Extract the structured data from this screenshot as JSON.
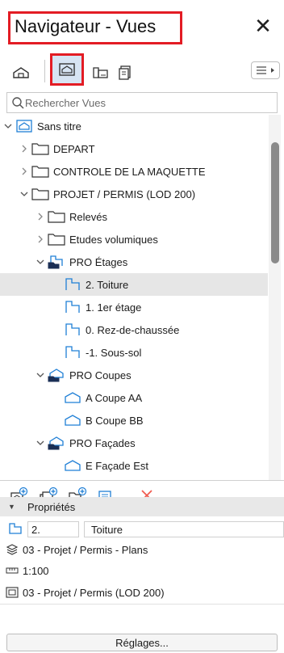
{
  "window": {
    "title": "Navigateur - Vues",
    "close_icon": "close-icon"
  },
  "toolbar": {
    "buttons": [
      {
        "name": "project-map-icon",
        "active": false
      },
      {
        "name": "view-map-icon",
        "active": true
      },
      {
        "name": "layout-book-icon",
        "active": false
      },
      {
        "name": "publisher-sets-icon",
        "active": false
      }
    ],
    "menu_icon": "options-menu-icon"
  },
  "search": {
    "placeholder": "Rechercher Vues",
    "value": ""
  },
  "tree": {
    "items": [
      {
        "label": "Sans titre",
        "level": 0,
        "expanded": true,
        "icon": "view-root-icon"
      },
      {
        "label": "DEPART",
        "level": 1,
        "expanded": false,
        "icon": "folder-icon"
      },
      {
        "label": "CONTROLE DE LA MAQUETTE",
        "level": 1,
        "expanded": false,
        "icon": "folder-icon"
      },
      {
        "label": "PROJET / PERMIS (LOD 200)",
        "level": 1,
        "expanded": true,
        "icon": "folder-icon"
      },
      {
        "label": "Relevés",
        "level": 2,
        "expanded": false,
        "icon": "folder-icon"
      },
      {
        "label": "Etudes volumiques",
        "level": 2,
        "expanded": false,
        "icon": "folder-icon"
      },
      {
        "label": "PRO Étages",
        "level": 2,
        "expanded": true,
        "icon": "story-folder-icon"
      },
      {
        "label": "2. Toiture",
        "level": 3,
        "icon": "story-view-icon",
        "selected": true
      },
      {
        "label": "1. 1er étage",
        "level": 3,
        "icon": "story-view-icon"
      },
      {
        "label": "0. Rez-de-chaussée",
        "level": 3,
        "icon": "story-view-icon"
      },
      {
        "label": "-1. Sous-sol",
        "level": 3,
        "icon": "story-view-icon"
      },
      {
        "label": "PRO Coupes",
        "level": 2,
        "expanded": true,
        "icon": "section-folder-icon"
      },
      {
        "label": "A Coupe AA",
        "level": 3,
        "icon": "section-view-icon"
      },
      {
        "label": "B Coupe BB",
        "level": 3,
        "icon": "section-view-icon"
      },
      {
        "label": "PRO Façades",
        "level": 2,
        "expanded": true,
        "icon": "elevation-folder-icon"
      },
      {
        "label": "E Façade Est",
        "level": 3,
        "icon": "elevation-view-icon"
      }
    ]
  },
  "bottom_toolbar": {
    "buttons": [
      "new-view-icon",
      "clone-folder-icon",
      "new-folder-icon",
      "settings-list-icon",
      "delete-icon"
    ]
  },
  "properties": {
    "header": "Propriétés",
    "id_value": "2.",
    "name_value": "Toiture",
    "layer_combination": "03 - Projet / Permis - Plans",
    "scale": "1:100",
    "model_view": "03 - Projet / Permis (LOD 200)",
    "settings_button": "Réglages..."
  },
  "colors": {
    "accent_red": "#e31c24",
    "icon_blue": "#1f7fd6",
    "selected_row": "#e6e6e6",
    "delete_red": "#f05b4f"
  }
}
